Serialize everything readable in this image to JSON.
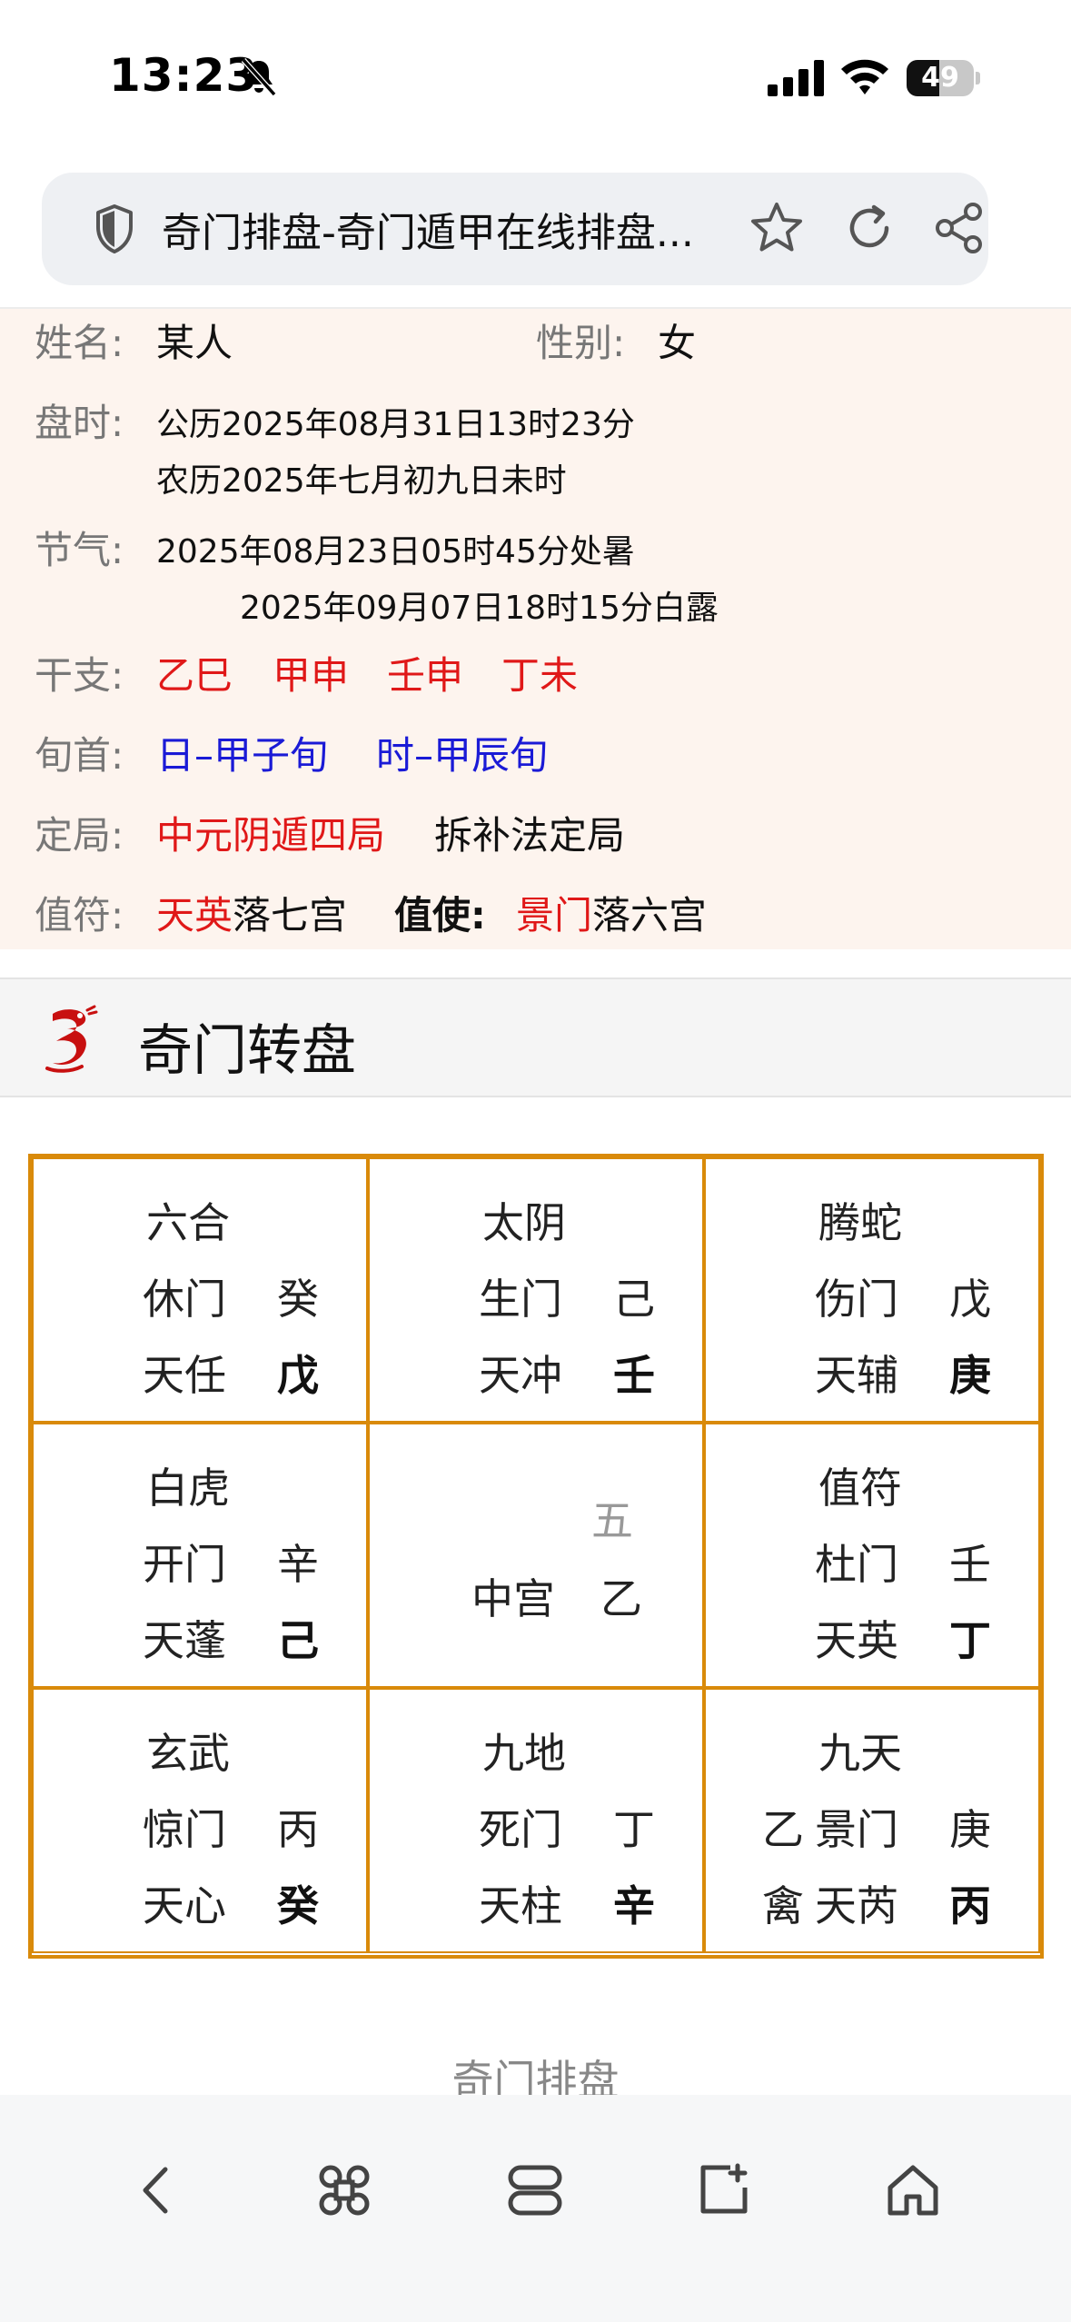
{
  "status": {
    "time": "13:23",
    "battery": "49",
    "battery_level": 0.49
  },
  "url_bar": {
    "title": "奇门排盘-奇门遁甲在线排盘..."
  },
  "info": {
    "name_label": "姓名:",
    "name_value": "某人",
    "gender_label": "性别:",
    "gender_value": "女",
    "time_label": "盘时:",
    "solar": "公历2025年08月31日13时23分",
    "lunar": "农历2025年七月初九日未时",
    "jieqi_label": "节气:",
    "jieqi_1": "2025年08月23日05时45分处暑",
    "jieqi_2": "2025年09月07日18时15分白露",
    "ganzhi_label": "干支:",
    "ganzhi": [
      "乙巳",
      "甲申",
      "壬申",
      "丁未"
    ],
    "xunshou_label": "旬首:",
    "xunshou": [
      "日–甲子旬",
      "时–甲辰旬"
    ],
    "ju_label": "定局:",
    "ju_value": "中元阴遁四局",
    "ju_method": "拆补法定局",
    "zhifu_label": "值符:",
    "zhifu_star": "天英",
    "zhifu_rest": "落七宫",
    "zhishi_label": "值使:",
    "zhishi_door": "景门",
    "zhishi_rest": "落六宫"
  },
  "section": {
    "title": "奇门转盘"
  },
  "palaces": [
    {
      "god": "六合",
      "door": "休门",
      "door_stem": "癸",
      "star": "天任",
      "star_stem": "戊"
    },
    {
      "god": "太阴",
      "door": "生门",
      "door_stem": "己",
      "star": "天冲",
      "star_stem": "壬"
    },
    {
      "god": "腾蛇",
      "door": "伤门",
      "door_stem": "戊",
      "star": "天辅",
      "star_stem": "庚"
    },
    {
      "god": "白虎",
      "door": "开门",
      "door_stem": "辛",
      "star": "天蓬",
      "star_stem": "己"
    },
    {
      "num": "五",
      "label": "中宫",
      "stem": "乙"
    },
    {
      "god": "值符",
      "door": "杜门",
      "door_stem": "壬",
      "star": "天英",
      "star_stem": "丁"
    },
    {
      "god": "玄武",
      "door": "惊门",
      "door_stem": "丙",
      "star": "天心",
      "star_stem": "癸"
    },
    {
      "god": "九地",
      "door": "死门",
      "door_stem": "丁",
      "star": "天柱",
      "star_stem": "辛"
    },
    {
      "god": "九天",
      "pre_door": "乙",
      "door": "景门",
      "door_stem": "庚",
      "pre_star": "禽",
      "star": "天芮",
      "star_stem": "丙"
    }
  ],
  "footer": {
    "label": "奇门排盘"
  }
}
